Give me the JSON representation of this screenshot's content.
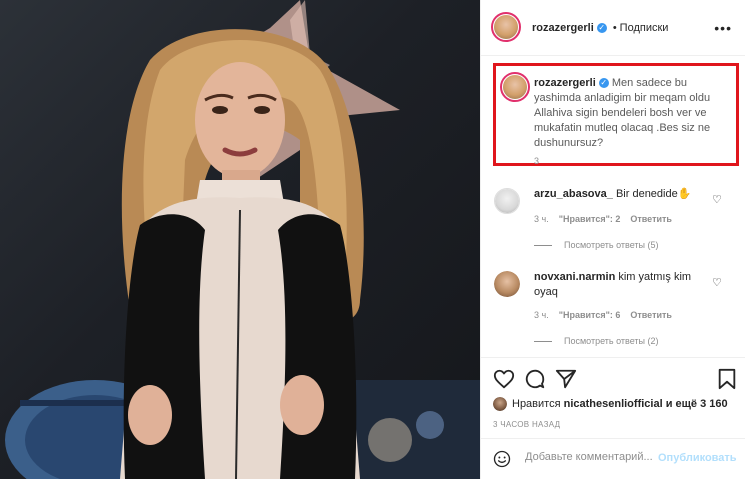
{
  "author": {
    "username": "rozazergerli",
    "verified_mark": "✓",
    "follow_separator": "•",
    "follow_label": "Подписки",
    "more_icon": "more-horizontal-icon"
  },
  "caption": {
    "username": "rozazergerli",
    "text": "Men sadece bu yashimda anladigim bir meqam oldu Allahiva sigin bendeleri bosh ver ve mukafatin mutleq olacaq .Bes siz ne dushunursuz?",
    "time": "3"
  },
  "comments": [
    {
      "username": "arzu_abasova_",
      "text": "Bir denedide✋",
      "time": "3 ч.",
      "likes": "\"Нравится\": 2",
      "reply_label": "Ответить",
      "view_replies": "Посмотреть ответы (5)"
    },
    {
      "username": "novxani.narmin",
      "text": "kim yatmış kim oyaq",
      "time": "3 ч.",
      "likes": "\"Нравится\": 6",
      "reply_label": "Ответить",
      "view_replies": "Посмотреть ответы (2)"
    }
  ],
  "actions": {
    "like_icon": "heart-icon",
    "comment_icon": "comment-icon",
    "share_icon": "share-icon",
    "save_icon": "bookmark-icon"
  },
  "likes": {
    "prefix": "Нравится",
    "user": "nicathesenliofficial",
    "suffix": "и ещё 3 160"
  },
  "posted_ago": "3 ЧАСОВ НАЗАД",
  "add_comment": {
    "placeholder": "Добавьте комментарий...",
    "publish_label": "Опубликовать"
  },
  "colors": {
    "highlight_border": "#e0161c",
    "verified": "#3897f0",
    "publish_disabled": "#b2dffc",
    "muted_text": "#8e8e8e"
  }
}
